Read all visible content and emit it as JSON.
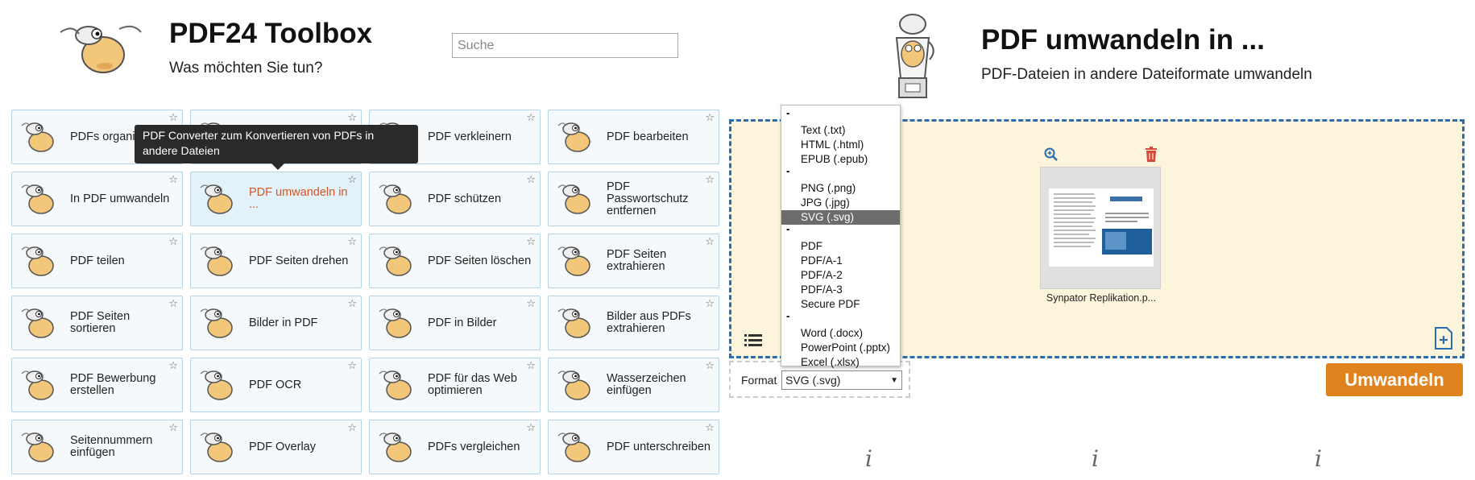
{
  "left": {
    "title": "PDF24 Toolbox",
    "subtitle": "Was möchten Sie tun?",
    "search_placeholder": "Suche",
    "tooltip": "PDF Converter zum Konvertieren von PDFs in andere Dateien",
    "tools": [
      {
        "label": "PDFs organisieren",
        "icon": "sheep-icon"
      },
      {
        "label": "",
        "icon": "sheep-icon"
      },
      {
        "label": "PDF verkleinern",
        "icon": "sheep-icon"
      },
      {
        "label": "PDF bearbeiten",
        "icon": "sheep-icon"
      },
      {
        "label": "In PDF umwandeln",
        "icon": "sheep-hat-icon"
      },
      {
        "label": "PDF umwandeln in ...",
        "icon": "sheep-blender-icon",
        "active": true
      },
      {
        "label": "PDF schützen",
        "icon": "sheep-icon"
      },
      {
        "label": "PDF Passwortschutz entfernen",
        "icon": "sheep-icon"
      },
      {
        "label": "PDF teilen",
        "icon": "sheep-axe-icon"
      },
      {
        "label": "PDF Seiten drehen",
        "icon": "sheep-icon"
      },
      {
        "label": "PDF Seiten löschen",
        "icon": "sheep-book-icon"
      },
      {
        "label": "PDF Seiten extrahieren",
        "icon": "sheep-icon"
      },
      {
        "label": "PDF Seiten sortieren",
        "icon": "pages-icon"
      },
      {
        "label": "Bilder in PDF",
        "icon": "picture-icon"
      },
      {
        "label": "PDF in Bilder",
        "icon": "document-icon"
      },
      {
        "label": "Bilder aus PDFs extrahieren",
        "icon": "sheep-icon"
      },
      {
        "label": "PDF Bewerbung erstellen",
        "icon": "sheep-board-icon"
      },
      {
        "label": "PDF OCR",
        "icon": "sheep-icon"
      },
      {
        "label": "PDF für das Web optimieren",
        "icon": "sheep-icon"
      },
      {
        "label": "Wasserzeichen einfügen",
        "icon": "sheep-icon"
      },
      {
        "label": "Seitennummern einfügen",
        "icon": "numbers-icon"
      },
      {
        "label": "PDF Overlay",
        "icon": "sheep-icon"
      },
      {
        "label": "PDFs vergleichen",
        "icon": "sheep-icon"
      },
      {
        "label": "PDF unterschreiben",
        "icon": "sheep-pen-icon"
      }
    ],
    "star": "☆"
  },
  "right": {
    "title": "PDF umwandeln in ...",
    "subtitle": "PDF-Dateien in andere Dateiformate umwandeln",
    "file_name": "Synpator Replikation.p...",
    "format_label": "Format",
    "format_value": "SVG (.svg)",
    "convert_label": "Umwandeln",
    "dropdown": [
      {
        "type": "sep",
        "label": "-"
      },
      {
        "type": "opt",
        "label": "Text (.txt)"
      },
      {
        "type": "opt",
        "label": "HTML (.html)"
      },
      {
        "type": "opt",
        "label": "EPUB (.epub)"
      },
      {
        "type": "sep",
        "label": "-"
      },
      {
        "type": "opt",
        "label": "PNG (.png)"
      },
      {
        "type": "opt",
        "label": "JPG (.jpg)"
      },
      {
        "type": "opt",
        "label": "SVG (.svg)",
        "selected": true
      },
      {
        "type": "sep",
        "label": "-"
      },
      {
        "type": "opt",
        "label": "PDF"
      },
      {
        "type": "opt",
        "label": "PDF/A-1"
      },
      {
        "type": "opt",
        "label": "PDF/A-2"
      },
      {
        "type": "opt",
        "label": "PDF/A-3"
      },
      {
        "type": "opt",
        "label": "Secure PDF"
      },
      {
        "type": "sep",
        "label": "-"
      },
      {
        "type": "opt",
        "label": "Word (.docx)"
      },
      {
        "type": "opt",
        "label": "PowerPoint (.pptx)"
      },
      {
        "type": "opt",
        "label": "Excel (.xlsx)"
      }
    ],
    "info_symbol": "i"
  },
  "colors": {
    "accent_orange": "#e0821d",
    "drop_border": "#2a6cb0",
    "drop_bg": "#fcf5dc",
    "active_label": "#d4572a",
    "tile_border": "#b5d4e6"
  }
}
